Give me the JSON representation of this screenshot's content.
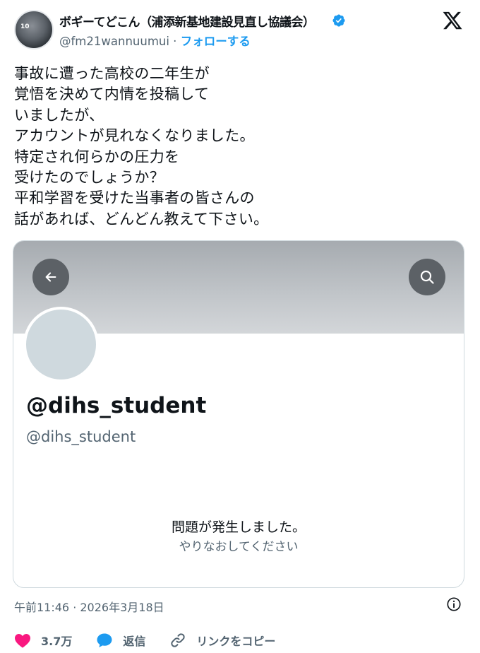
{
  "author": {
    "name": "ボギーてどこん（浦添新基地建設見直し協議会）",
    "handle": "@fm21wannuumui",
    "separator": " · ",
    "follow_label": "フォローする",
    "avatar_badge": "10"
  },
  "tweet": {
    "lines": [
      "事故に遭った高校の二年生が",
      "覚悟を決めて内情を投稿して",
      "いましたが、",
      "アカウントが見れなくなりました。",
      "特定され何らかの圧力を",
      "受けたのでしょうか？",
      "平和学習を受けた当事者の皆さんの",
      "話があれば、どんどん教えて下さい。"
    ],
    "timestamp": "午前11:46 · 2026年3月18日"
  },
  "embedded_profile": {
    "display_name": "@dihs_student",
    "handle": "@dihs_student",
    "error_title": "問題が発生しました。",
    "error_subtitle": "やりなおしてください"
  },
  "actions": {
    "like_count": "3.7万",
    "reply_label": "返信",
    "copy_link_label": "リンクをコピー"
  },
  "icons": [
    "verified-icon",
    "x-logo-icon",
    "back-arrow-icon",
    "search-icon",
    "info-icon",
    "heart-icon",
    "reply-icon",
    "link-icon"
  ],
  "colors": {
    "accent": "#1d9bf0",
    "like": "#f91880",
    "muted": "#536471",
    "text": "#0f1419"
  }
}
